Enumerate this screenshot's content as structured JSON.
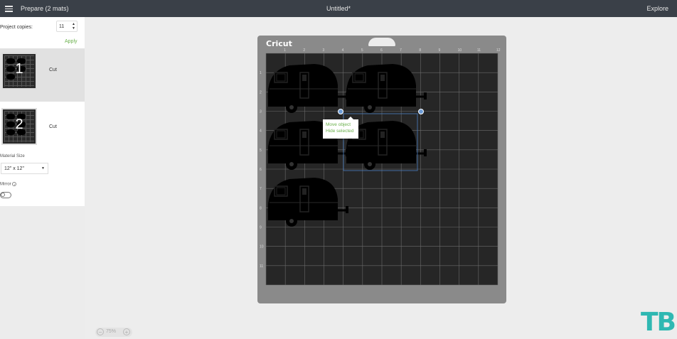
{
  "header": {
    "title": "Prepare (2 mats)",
    "document_name": "Untitled*",
    "right_link": "Explore"
  },
  "left_panel": {
    "project_copies_label": "Project copies:",
    "project_copies_value": "11",
    "apply_label": "Apply",
    "mats": [
      {
        "number": "1",
        "label": "Cut",
        "selected": true
      },
      {
        "number": "2",
        "label": "Cut",
        "selected": false
      }
    ],
    "material_size_label": "Material Size",
    "material_size_value": "12\" x 12\"",
    "mirror_label": "Mirror",
    "mirror_info_icon": "i",
    "mirror_on": false
  },
  "mat": {
    "brand": "Cricut",
    "top_ruler": [
      "1",
      "2",
      "3",
      "4",
      "5",
      "6",
      "7",
      "8",
      "9",
      "10",
      "11",
      "12"
    ],
    "left_ruler": [
      "1",
      "2",
      "3",
      "4",
      "5",
      "6",
      "7",
      "8",
      "9",
      "10",
      "11"
    ]
  },
  "context_menu": {
    "items": [
      "Move object",
      "Hide selected"
    ]
  },
  "zoom": {
    "minus": "−",
    "value": "75%",
    "plus": "+"
  },
  "watermark": "TB",
  "colors": {
    "topbar": "#3a4048",
    "accent_green": "#6ab04c",
    "mat_grey": "#8a8a8a",
    "mat_surface": "#262626",
    "selection_blue": "#6c9bd6",
    "watermark": "#2fb8b2"
  }
}
